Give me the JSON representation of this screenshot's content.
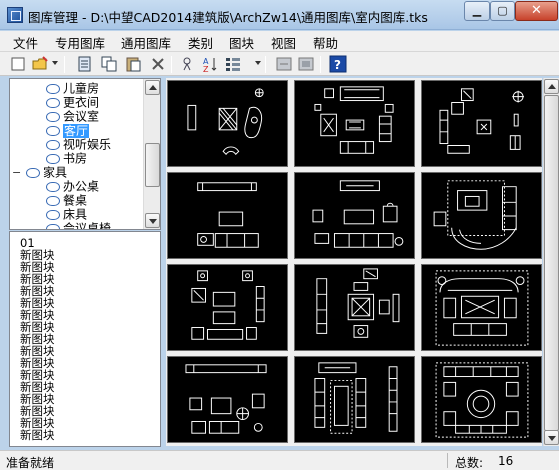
{
  "window": {
    "title": "图库管理 - D:\\中望CAD2014建筑版\\ArchZw14\\通用图库\\室内图库.tks"
  },
  "menu": [
    "文件",
    "专用图库",
    "通用图库",
    "类别",
    "图块",
    "视图",
    "帮助"
  ],
  "toolbar": {
    "icons": [
      "new-icon",
      "open-icon",
      "import-icon",
      "copy-icon",
      "paste-icon",
      "delete-icon",
      "sort-icon",
      "sort-az-icon",
      "view-icon",
      "insert-icon",
      "replace-icon",
      "help-icon"
    ]
  },
  "tree": {
    "items": [
      {
        "label": "儿童房",
        "expander": ""
      },
      {
        "label": "更衣间",
        "expander": ""
      },
      {
        "label": "会议室",
        "expander": ""
      },
      {
        "label": "客厅",
        "expander": "",
        "selected": true
      },
      {
        "label": "视听娱乐",
        "expander": ""
      },
      {
        "label": "书房",
        "expander": ""
      },
      {
        "label": "家具",
        "expander": "−"
      },
      {
        "label": "办公桌",
        "expander": ""
      },
      {
        "label": "餐桌",
        "expander": ""
      },
      {
        "label": "床具",
        "expander": ""
      },
      {
        "label": "会议桌椅",
        "expander": ""
      }
    ]
  },
  "list": {
    "items": [
      "01",
      "新图块",
      "新图块",
      "新图块",
      "新图块",
      "新图块",
      "新图块",
      "新图块",
      "新图块",
      "新图块",
      "新图块",
      "新图块",
      "新图块",
      "新图块",
      "新图块",
      "新图块",
      "新图块"
    ]
  },
  "preview": {
    "cell_count": 12
  },
  "status": {
    "text": "准备就绪",
    "count_label": "总数:",
    "count": "16"
  },
  "colors": {
    "cad_background": "#000000",
    "cad_lines": "#ffffff",
    "selection": "#3399ff"
  }
}
